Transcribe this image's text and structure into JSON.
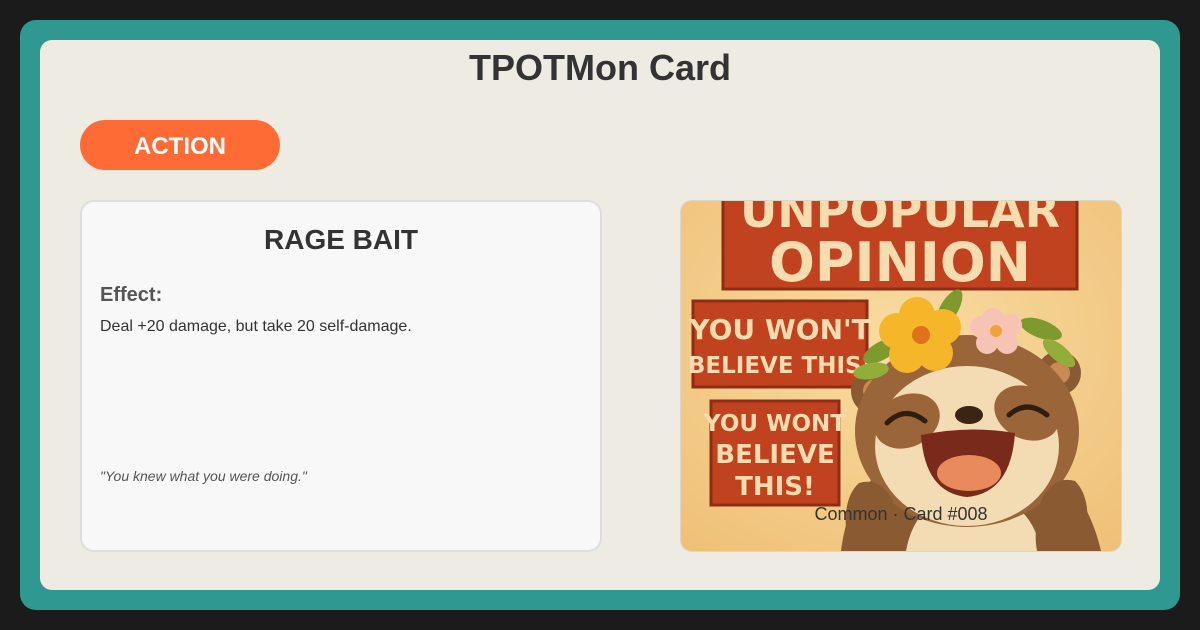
{
  "page": {
    "title": "TPOTMon Card"
  },
  "card": {
    "type_label": "ACTION",
    "name": "RAGE BAIT",
    "effect_label": "Effect:",
    "effect_text": "Deal +20 damage, but take 20 self-damage.",
    "flavor_text": "\"You knew what you were doing.\"",
    "footer": "Common · Card #008"
  },
  "art": {
    "banner_line1": "UNPOPULAR",
    "banner_line2": "OPINION",
    "sign1_line1": "YOU WON'T",
    "sign1_line2": "BELIEVE THIS!",
    "sign2_line1": "YOU WONT",
    "sign2_line2": "BELIEVE",
    "sign2_line3": "THIS!"
  },
  "colors": {
    "frame": "#2f9890",
    "card_bg": "#eeebe2",
    "badge": "#ff6b35",
    "sign_red": "#c0421e",
    "sign_text": "#f6dcae"
  }
}
